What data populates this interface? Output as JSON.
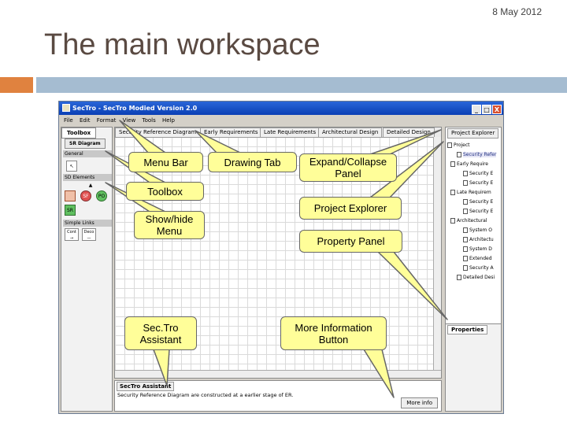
{
  "slide": {
    "date": "8 May 2012",
    "title": "The main workspace"
  },
  "colors": {
    "accent_orange": "#e0823f",
    "accent_blue": "#a5bcd1",
    "callout_fill": "#fffe99",
    "window_title": "#0a3fb5"
  },
  "window": {
    "title": "SecTro - SecTro Modied Version 2.0",
    "btn_min": "_",
    "btn_max": "□",
    "btn_close": "X"
  },
  "menubar": [
    "File",
    "Edit",
    "Format",
    "View",
    "Tools",
    "Help"
  ],
  "toolbox": {
    "tab": "Toolbox",
    "sr_tab": "SR Diagram",
    "sec_general": "General",
    "sec_sd": "SD Elements",
    "sec_links": "Simple Links",
    "icons": {
      "sf": "SF",
      "po": "PO",
      "sr": "SR",
      "cont": "Cont",
      "deco": "Deco"
    }
  },
  "drawing": {
    "tabs": [
      "Security Reference Diagram",
      "Early Requirements",
      "Late Requirements",
      "Architectural Design",
      "Detailed Design"
    ]
  },
  "assistant": {
    "tab": "SecTro Assistant",
    "text": "Security Reference Diagram are constructed at a earlier stage of ER.",
    "more_info": "More info"
  },
  "explorer": {
    "tab": "Project Explorer",
    "items": [
      "Project",
      "Security Refer",
      "Early Require",
      "Security E",
      "Security E",
      "Late Requirem",
      "Security E",
      "Security E",
      "Architectural",
      "System O",
      "Architectu",
      "System D",
      "Extended",
      "Security A",
      "Detailed Desi"
    ]
  },
  "properties": {
    "tab": "Properties"
  },
  "callouts": {
    "menu_bar": "Menu Bar",
    "drawing_tab": "Drawing Tab",
    "expand_collapse": "Expand/Collapse Panel",
    "toolbox": "Toolbox",
    "show_hide": "Show/hide Menu",
    "project_explorer": "Project Explorer",
    "property_panel": "Property Panel",
    "assistant": "Sec.Tro Assistant",
    "more_info": "More Information Button"
  }
}
